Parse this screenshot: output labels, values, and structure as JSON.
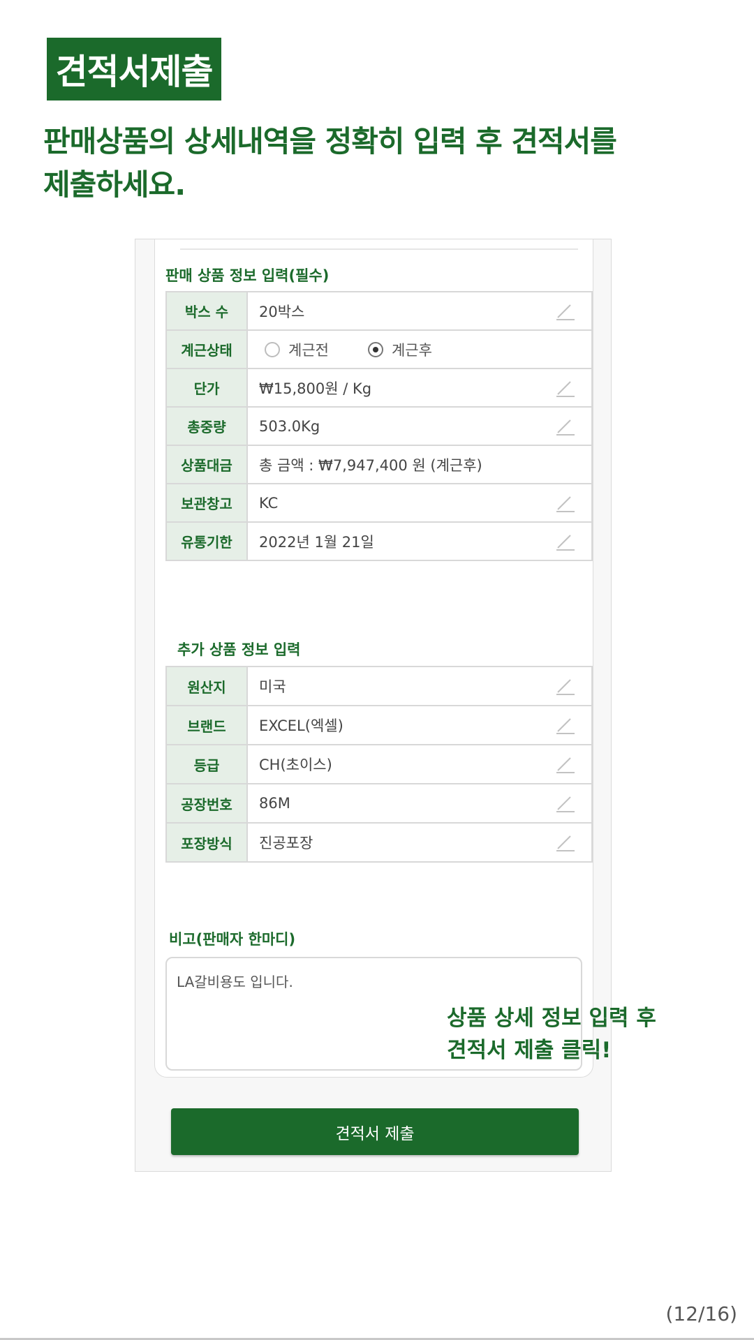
{
  "header": {
    "title": "견적서제출",
    "intro_line1": "판매상품의 상세내역을 정확히 입력 후 견적서를",
    "intro_line2": "제출하세요."
  },
  "required_section": {
    "label": "판매 상품 정보 입력(필수)",
    "rows": [
      {
        "label": "박스 수",
        "value": "20박스",
        "editable": true
      },
      {
        "label": "계근상태",
        "type": "radio",
        "options": [
          "계근전",
          "계근후"
        ],
        "selected": "계근후"
      },
      {
        "label": "단가",
        "value": "₩15,800원 / Kg",
        "editable": true
      },
      {
        "label": "총중량",
        "value": "503.0Kg",
        "editable": true
      },
      {
        "label": "상품대금",
        "value": "총 금액 : ₩7,947,400 원 (계근후)",
        "editable": false
      },
      {
        "label": "보관창고",
        "value": "KC",
        "editable": true
      },
      {
        "label": "유통기한",
        "value": "2022년 1월 21일",
        "editable": true
      }
    ]
  },
  "additional_section": {
    "label": "추가 상품 정보 입력",
    "rows": [
      {
        "label": "원산지",
        "value": "미국",
        "editable": true
      },
      {
        "label": "브랜드",
        "value": "EXCEL(엑셀)",
        "editable": true
      },
      {
        "label": "등급",
        "value": "CH(초이스)",
        "editable": true
      },
      {
        "label": "공장번호",
        "value": "86M",
        "editable": true
      },
      {
        "label": "포장방식",
        "value": "진공포장",
        "editable": true
      }
    ]
  },
  "memo": {
    "label": "비고(판매자 한마디)",
    "value": "LA갈비용도 입니다."
  },
  "submit_label": "견적서 제출",
  "callout": {
    "line1": "상품 상세 정보 입력 후",
    "line2": "견적서 제출 클릭!"
  },
  "page_indicator": "(12/16)",
  "colors": {
    "brand_green": "#1b6a2b",
    "label_bg": "#e6efe7"
  },
  "icons": {
    "edit": "pencil-icon"
  }
}
